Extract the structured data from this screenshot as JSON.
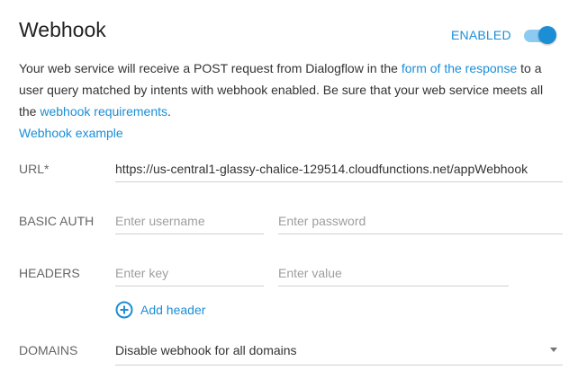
{
  "header": {
    "title": "Webhook",
    "status_label": "ENABLED",
    "enabled": true,
    "accent_color": "#1b8ed6"
  },
  "description": {
    "part1": "Your web service will receive a POST request from Dialogflow in the ",
    "link1": "form of the response",
    "part2": " to a user query matched by intents with webhook enabled. Be sure that your web service meets all the ",
    "link2": "webhook requirements",
    "part3": "."
  },
  "example_link": "Webhook example",
  "url": {
    "label": "URL*",
    "value": "https://us-central1-glassy-chalice-129514.cloudfunctions.net/appWebhook"
  },
  "basic_auth": {
    "label": "BASIC AUTH",
    "username_placeholder": "Enter username",
    "password_placeholder": "Enter password"
  },
  "headers": {
    "label": "HEADERS",
    "key_placeholder": "Enter key",
    "value_placeholder": "Enter value",
    "add_label": "Add header",
    "add_icon": "plus-circle-icon"
  },
  "domains": {
    "label": "DOMAINS",
    "selected": "Disable webhook for all domains",
    "icon": "caret-down-icon"
  }
}
